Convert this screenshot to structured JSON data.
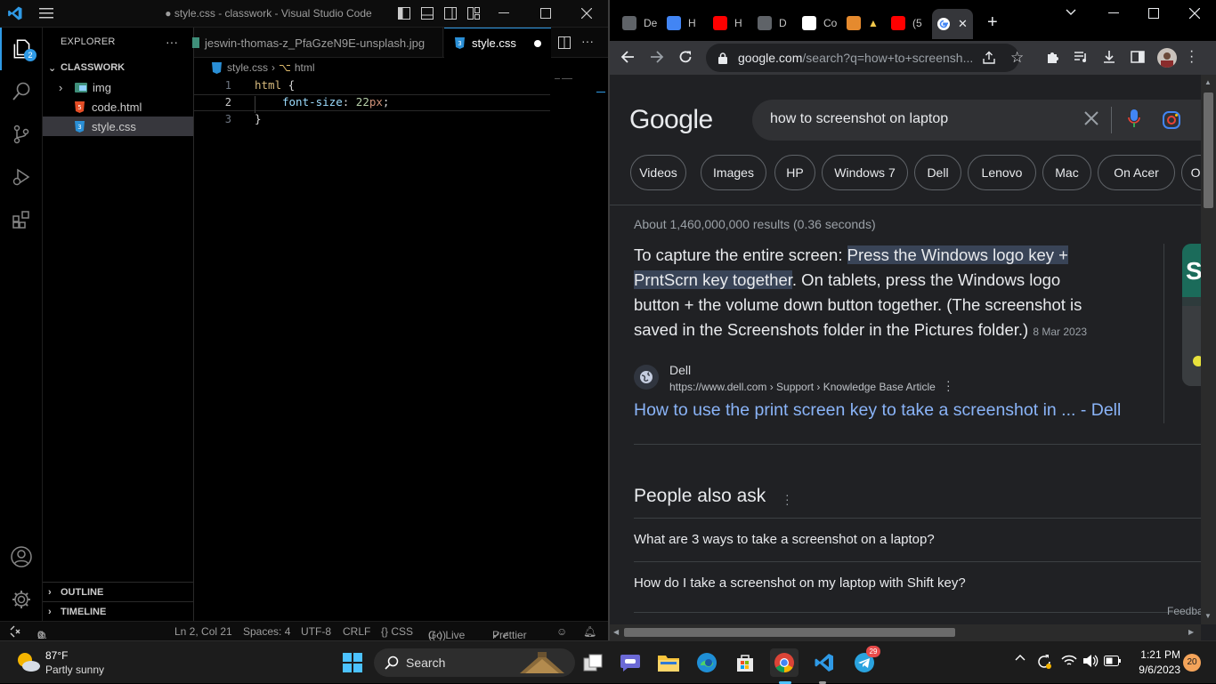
{
  "vscode": {
    "window_title": "● style.css - classwork - Visual Studio Code",
    "accounts_badge": "2",
    "explorer_title": "EXPLORER",
    "more": "···",
    "folder_name": "CLASSWORK",
    "tree": [
      {
        "name": "img"
      },
      {
        "name": "code.html"
      },
      {
        "name": "style.css"
      }
    ],
    "outline_label": "OUTLINE",
    "timeline_label": "TIMELINE",
    "tabs": [
      {
        "label": "jeswin-thomas-z_PfaGzeN9E-unsplash.jpg"
      },
      {
        "label": "style.css"
      }
    ],
    "breadcrumb": {
      "file": "style.css",
      "sep": "›",
      "symbol": "html"
    },
    "code": {
      "line_numbers": [
        "1",
        "2",
        "3"
      ],
      "line1_sel": "html",
      "line1_brace": " {",
      "line2_prop": "font-size",
      "line2_colon": ": ",
      "line2_num": "22",
      "line2_unit": "px",
      "line2_semi": ";",
      "line3": "}"
    },
    "status": {
      "errors": "0",
      "warnings": "0",
      "cursor": "Ln 2, Col 21",
      "spaces": "Spaces: 4",
      "encoding": "UTF-8",
      "eol": "CRLF",
      "lang": "{} CSS",
      "golive": "Go Live",
      "prettier": "Prettier"
    }
  },
  "chrome": {
    "tabs": [
      {
        "label": "De",
        "color": "#5f6368"
      },
      {
        "label": "H",
        "color": "#4285f4"
      },
      {
        "label": "H",
        "color": "#ff0000"
      },
      {
        "label": "D",
        "color": "#5f6368"
      },
      {
        "label": "Co",
        "color": "#ffffff"
      },
      {
        "label": "",
        "color": "#e58a2e"
      },
      {
        "label": "(5",
        "color": "#ff0000"
      }
    ],
    "url_domain": "google.com",
    "url_rest": "/search?q=how+to+screensh...",
    "google_logo": "Google",
    "search_query": "how to screenshot on laptop",
    "chips": [
      "Videos",
      "Images",
      "HP",
      "Windows 7",
      "Dell",
      "Lenovo",
      "Mac",
      "On Acer",
      "On"
    ],
    "result_stats": "About 1,460,000,000 results (0.36 seconds)",
    "snippet": {
      "line1_a": "To capture the entire screen: ",
      "line1_b": "Press the Windows logo key +",
      "line2_a": "PrntScrn key together",
      "line2_b": ". On tablets, press the Windows logo",
      "line3": "button + the volume down button together. (The screenshot is",
      "line4": "saved in the Screenshots folder in the Pictures folder.)",
      "date": "8 Mar 2023"
    },
    "source": {
      "name": "Dell",
      "cite": "https://www.dell.com › Support › Knowledge Base Article",
      "link": "How to use the print screen key to take a screenshot in ... - Dell"
    },
    "paa_title": "People also ask",
    "paa": [
      "What are 3 ways to take a screenshot on a laptop?",
      "How do I take a screenshot on my laptop with Shift key?"
    ],
    "feedback": "Feedba"
  },
  "taskbar": {
    "weather_temp": "87°F",
    "weather_desc": "Partly sunny",
    "search_label": "Search",
    "telegram_badge": "29",
    "time": "1:21 PM",
    "date": "9/6/2023",
    "notif_count": "20"
  }
}
